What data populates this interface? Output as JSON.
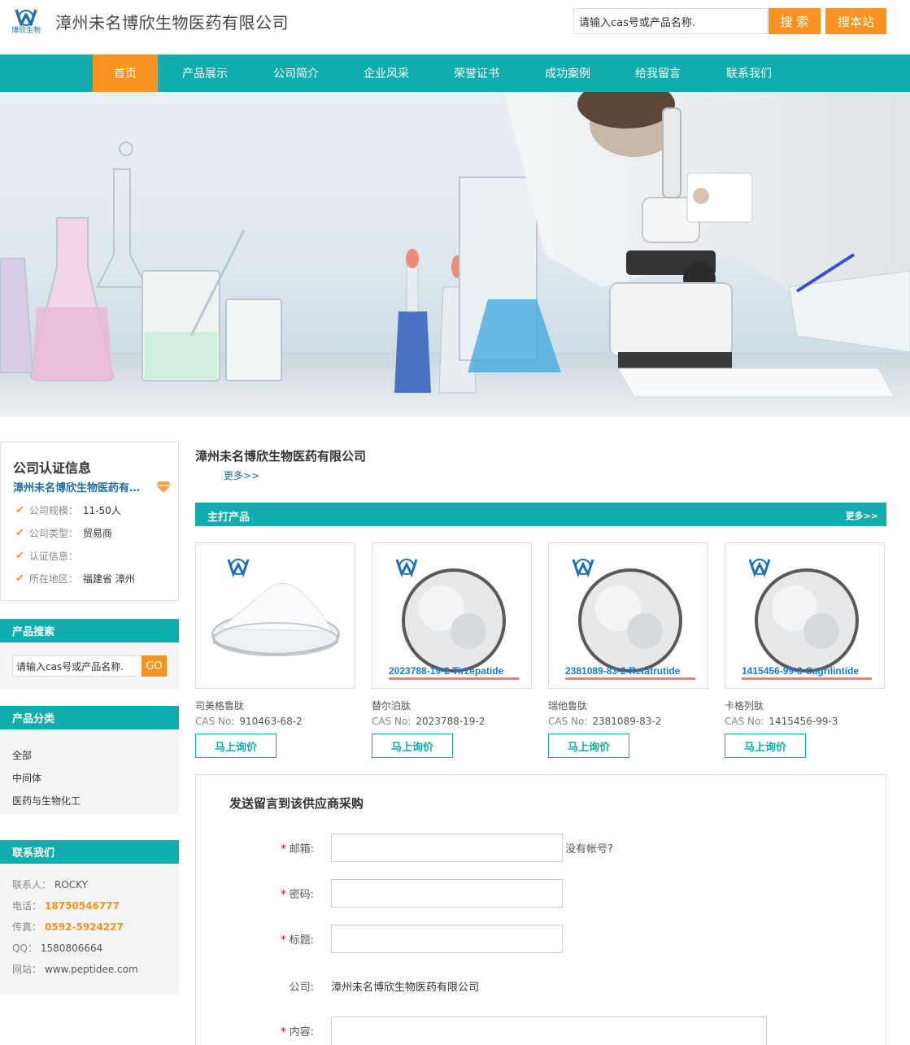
{
  "header": {
    "logo_text": "博欣生物",
    "company_name": "漳州未名博欣生物医药有限公司",
    "search_placeholder": "请输入cas号或产品名称.",
    "search_button": "搜 索",
    "site_button": "搜本站"
  },
  "nav": {
    "items": [
      {
        "label": "首页",
        "active": true
      },
      {
        "label": "产品展示"
      },
      {
        "label": "公司简介"
      },
      {
        "label": "企业风采"
      },
      {
        "label": "荣誉证书"
      },
      {
        "label": "成功案例"
      },
      {
        "label": "给我留言"
      },
      {
        "label": "联系我们"
      }
    ]
  },
  "cert": {
    "title": "公司认证信息",
    "company": "漳州未名博欣生物医药有限公司",
    "rows": [
      {
        "label": "公司规模：",
        "value": "11-50人"
      },
      {
        "label": "公司类型：",
        "value": "贸易商"
      },
      {
        "label": "认证信息：",
        "value": ""
      },
      {
        "label": "所在地区：",
        "value": "福建省 漳州"
      }
    ]
  },
  "side_search": {
    "title": "产品搜索",
    "placeholder": "请输入cas号或产品名称.",
    "go": "GO"
  },
  "categories": {
    "title": "产品分类",
    "items": [
      "全部",
      "中间体",
      "医药与生物化工"
    ]
  },
  "contact": {
    "title": "联系我们",
    "rows": [
      {
        "label": "联系人：",
        "value": "ROCKY",
        "highlight": false
      },
      {
        "label": "电话：",
        "value": "18750546777",
        "highlight": true
      },
      {
        "label": "传真：",
        "value": "0592-5924227",
        "highlight": true
      },
      {
        "label": "QQ：",
        "value": "1580806664",
        "highlight": false
      },
      {
        "label": "网站：",
        "value": "www.peptidee.com",
        "highlight": false
      }
    ]
  },
  "main": {
    "company": "漳州未名博欣生物医药有限公司",
    "more": "更多>>",
    "products_title": "主打产品",
    "products_more": "更多>>"
  },
  "products": [
    {
      "name": "司美格鲁肽",
      "cas_label": "CAS No:",
      "cas": "910463-68-2",
      "button": "马上询价",
      "image_text": ""
    },
    {
      "name": "替尔泊肽",
      "cas_label": "CAS No:",
      "cas": "2023788-19-2",
      "button": "马上询价",
      "image_text": "2023788-19-2   Tirzepatide"
    },
    {
      "name": "瑞他鲁肽",
      "cas_label": "CAS No:",
      "cas": "2381089-83-2",
      "button": "马上询价",
      "image_text": "2381089-83-2   Retatrutide"
    },
    {
      "name": "卡格列肽",
      "cas_label": "CAS No:",
      "cas": "1415456-99-3",
      "button": "马上询价",
      "image_text": "1415456-99-3   Cagrilintide"
    }
  ],
  "form": {
    "title": "发送留言到该供应商采购",
    "email_label": "邮箱:",
    "no_account": "没有帐号?",
    "password_label": "密码:",
    "subject_label": "标题:",
    "company_label": "公司:",
    "company_value": "漳州未名博欣生物医药有限公司",
    "content_label": "内容:",
    "required_mark": "*"
  },
  "colors": {
    "teal": "#11adad",
    "orange": "#f7931e",
    "link_blue": "#1f6fa0"
  }
}
